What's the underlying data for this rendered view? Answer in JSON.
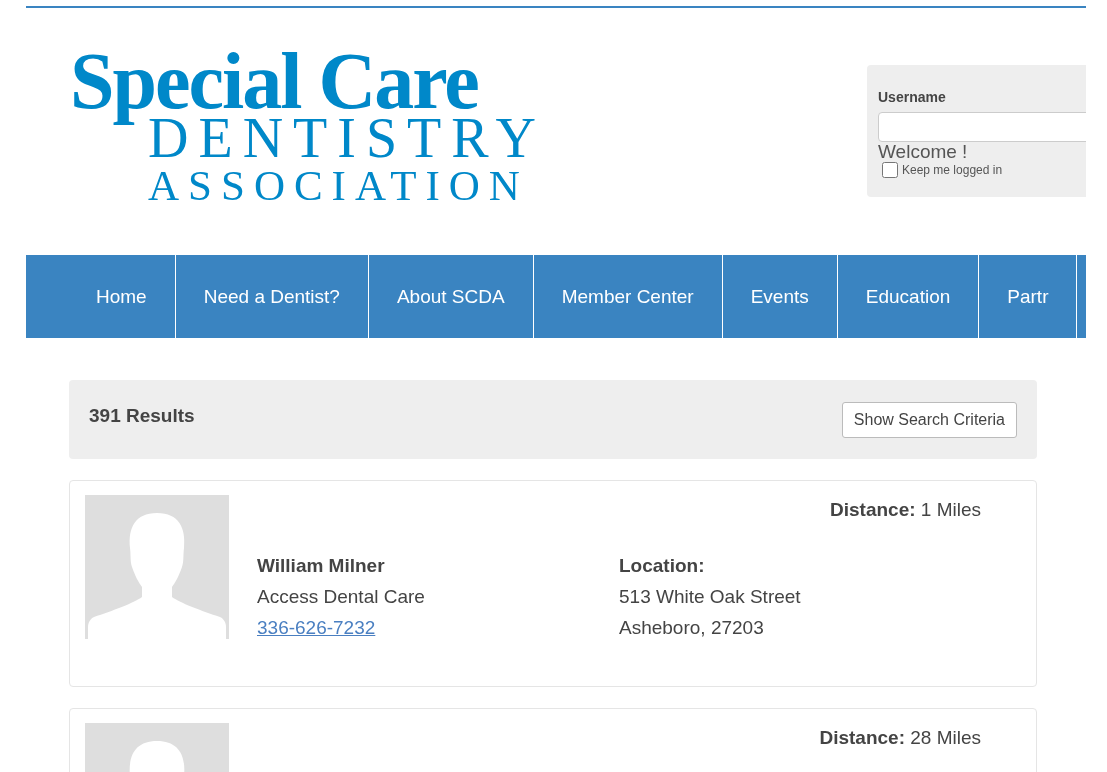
{
  "logo": {
    "line_1": "Special Care",
    "line_2": "DENTISTRY",
    "line_3": "ASSOCIATION"
  },
  "login": {
    "username_label": "Username",
    "welcome": "Welcome !",
    "keep_logged_in": {
      "label": "Keep me logged in",
      "checked": false
    }
  },
  "nav": [
    {
      "label": "Home"
    },
    {
      "label": "Need a Dentist?"
    },
    {
      "label": "About SCDA"
    },
    {
      "label": "Member Center"
    },
    {
      "label": "Events"
    },
    {
      "label": "Education"
    },
    {
      "label": "Partr"
    }
  ],
  "results": {
    "count": "391 Results",
    "button": "Show Search Criteria"
  },
  "listings": [
    {
      "distance_label": "Distance:",
      "distance": "1 Miles",
      "name": "William Milner",
      "practice": "Access Dental Care",
      "phone": "336-626-7232",
      "location_label": "Location:",
      "street": "513 White Oak Street",
      "city": "Asheboro, 27203"
    },
    {
      "distance_label": "Distance:",
      "distance": "28 Miles"
    }
  ]
}
